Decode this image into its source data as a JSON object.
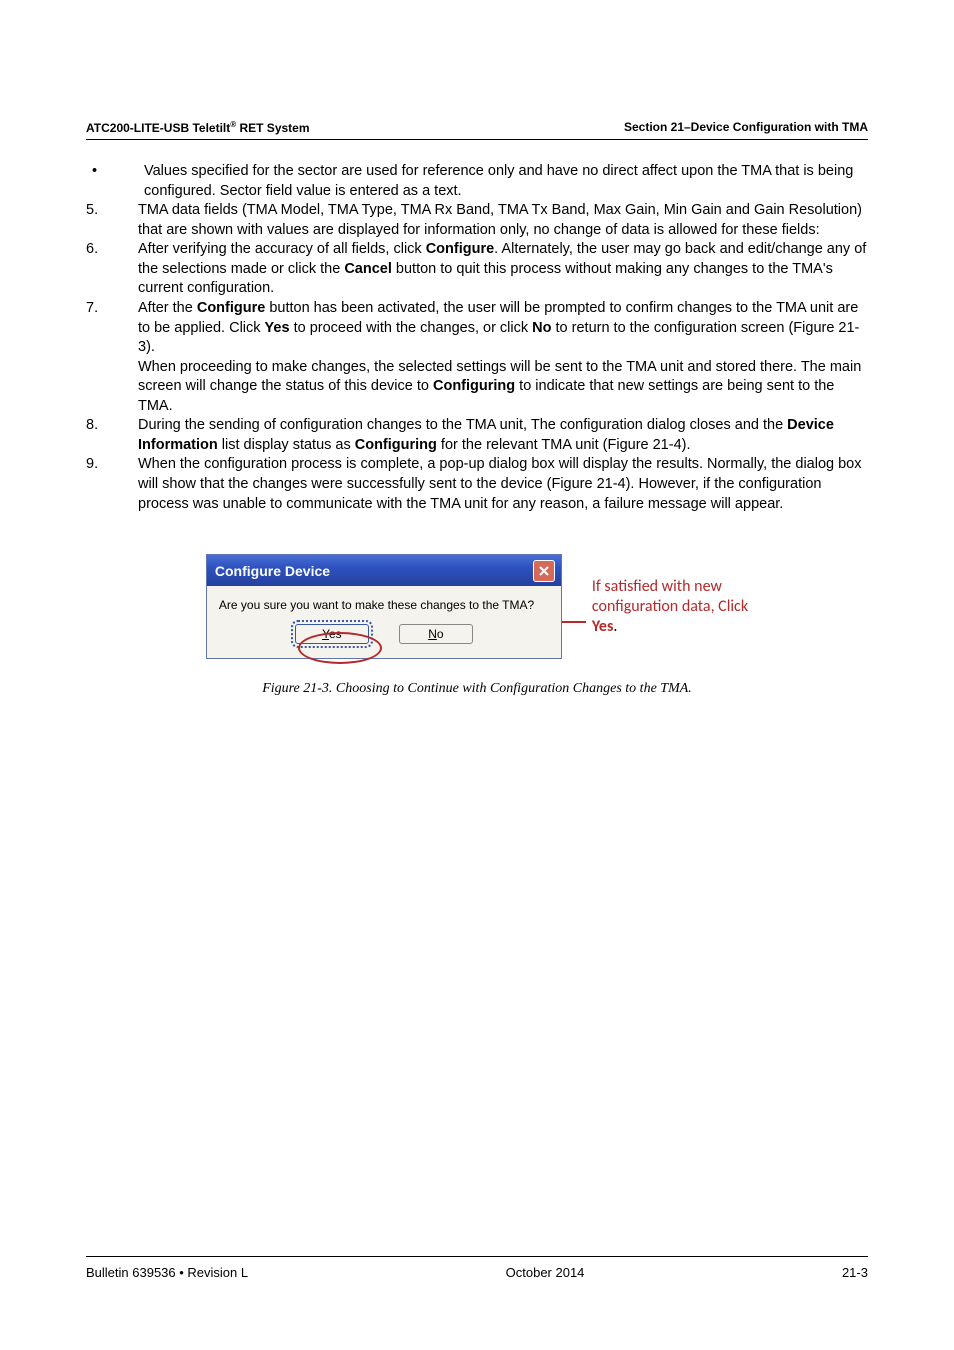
{
  "header": {
    "left_a": "ATC200-LITE-USB Teletilt",
    "left_sup": "®",
    "left_b": " RET System",
    "right": "Section 21–Device Configuration with TMA"
  },
  "items": [
    {
      "num": "•",
      "bullet": true,
      "html": "Values specified for the sector are used for reference only and have no direct affect upon the TMA that is being configured. Sector field value is entered as a text."
    },
    {
      "num": "5.",
      "html": "TMA data fields (TMA Model, TMA Type, TMA Rx Band, TMA Tx Band, Max Gain, Min Gain and Gain Resolution) that are shown with values are displayed for information only, no change of data is allowed for these fields:"
    },
    {
      "num": "6.",
      "html": "After verifying the accuracy of all fields, click <b>Configure</b>. Alternately, the user may go back and edit/change any of the selections made or click the <b>Cancel</b> button to quit this process without making any changes to the TMA's current configuration."
    },
    {
      "num": "7.",
      "html": "After the <b>Configure</b> button has been activated, the user will be prompted to confirm changes to the TMA unit are to be applied. Click <b>Yes</b> to proceed with the changes, or click <b>No</b> to return to the configuration screen (Figure 21-3).<br>When proceeding to make changes, the selected settings will be sent to the TMA unit and stored there. The main screen will change the status of this device to <b>Configuring</b> to indicate that new settings are being sent to the TMA."
    },
    {
      "num": "8.",
      "html": "During the sending of configuration changes to the TMA unit, The configuration dialog closes and the <b>Device Information</b> list display status as <b>Configuring</b> for the relevant TMA unit (Figure 21-4)."
    },
    {
      "num": "9.",
      "html": "When the configuration process is complete, a pop-up dialog box will display the results. Normally, the dialog box will show that the changes were successfully sent to the device (Figure 21-4). However, if the configuration process was unable to communicate with the TMA unit for any reason, a failure message will appear."
    }
  ],
  "dialog": {
    "title": "Configure Device",
    "message": "Are you sure you want to make these changes to the TMA?",
    "yes_u": "Y",
    "yes_r": "es",
    "no_u": "N",
    "no_r": "o"
  },
  "callout": {
    "l1": "If satisfied with new",
    "l2": "configuration data, Click",
    "l3": "Yes",
    "l3b": "."
  },
  "figcaption": "Figure 21-3. Choosing to Continue with Configuration Changes to the TMA.",
  "footer": {
    "left": "Bulletin 639536  •  Revision L",
    "center": "October 2014",
    "right": "21-3"
  }
}
